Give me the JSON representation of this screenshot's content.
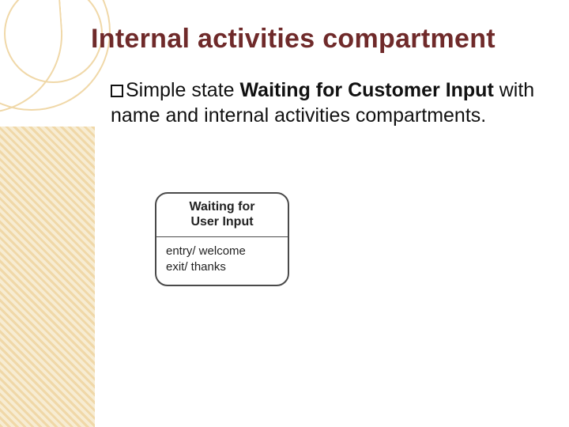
{
  "title": "Internal activities compartment",
  "body": {
    "pre": "Simple state ",
    "strong": "Waiting for Customer Input",
    "post": " with name and internal activities compartments."
  },
  "diagram": {
    "name_line1": "Waiting for",
    "name_line2": "User Input",
    "entry": "entry/ welcome",
    "exit": "exit/ thanks"
  }
}
